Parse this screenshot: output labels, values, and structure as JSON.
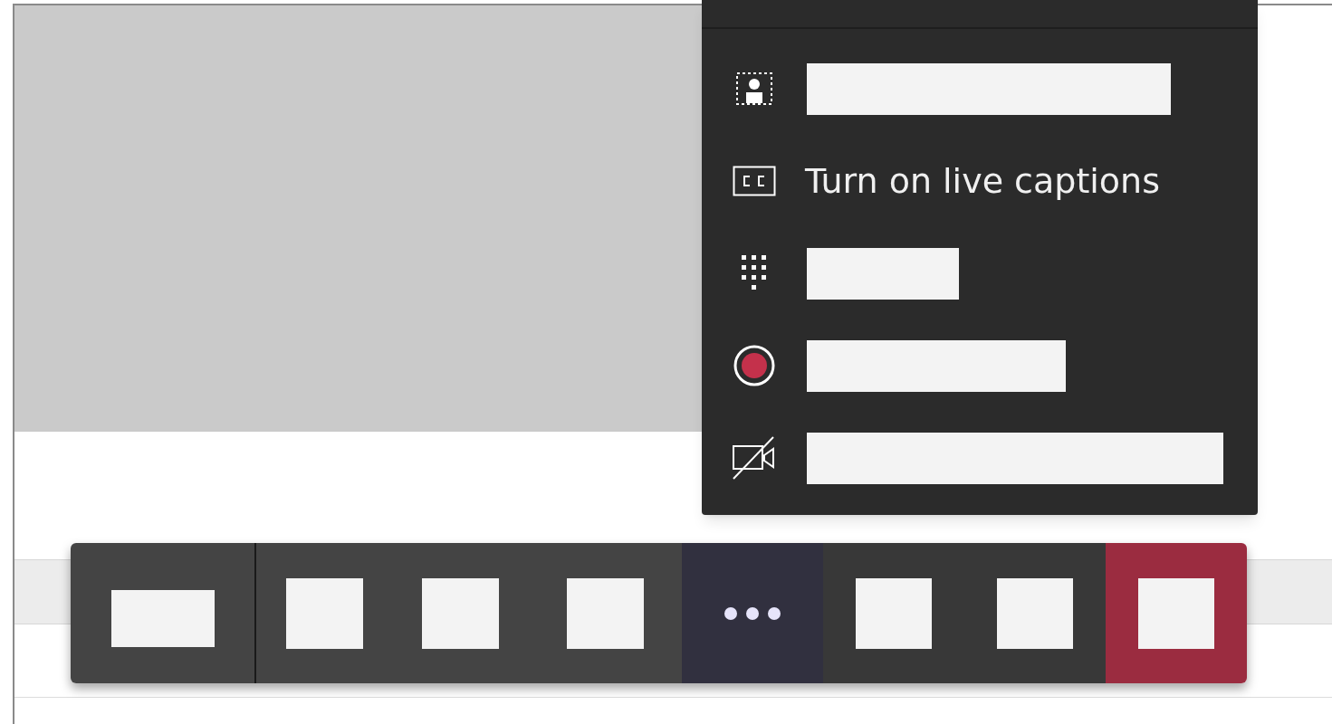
{
  "more_menu": {
    "items": [
      {
        "kind": "redacted"
      },
      {
        "kind": "text",
        "label": "Turn on live captions"
      },
      {
        "kind": "redacted"
      },
      {
        "kind": "redacted"
      },
      {
        "kind": "redacted"
      }
    ]
  },
  "toolbar": {
    "buttons": [
      {
        "kind": "redacted"
      },
      {
        "kind": "redacted"
      },
      {
        "kind": "redacted"
      },
      {
        "kind": "redacted"
      },
      {
        "kind": "more"
      },
      {
        "kind": "redacted"
      },
      {
        "kind": "redacted"
      },
      {
        "kind": "redacted"
      }
    ]
  }
}
